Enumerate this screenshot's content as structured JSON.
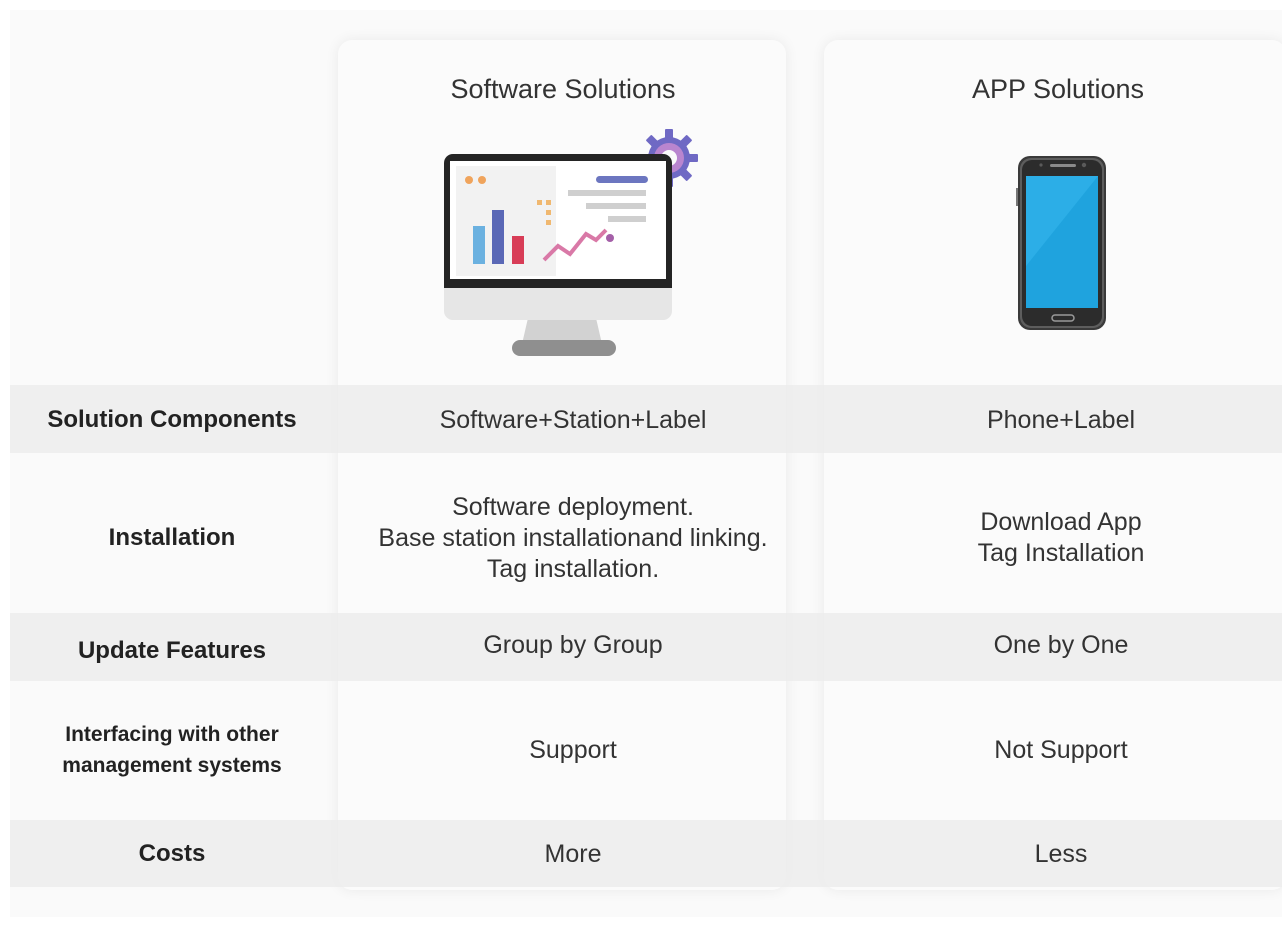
{
  "columns": {
    "software": {
      "title": "Software Solutions",
      "icon": "monitor-dashboard-icon"
    },
    "app": {
      "title": "APP Solutions",
      "icon": "smartphone-icon"
    }
  },
  "rows": [
    {
      "label": "Solution Components",
      "software": "Software+Station+Label",
      "app": "Phone+Label"
    },
    {
      "label": "Installation",
      "software": [
        "Software deployment.",
        "Base station installationand linking.",
        "Tag installation."
      ],
      "app": [
        "Download App",
        "Tag Installation"
      ]
    },
    {
      "label": "Update Features",
      "software": "Group by Group",
      "app": "One by One"
    },
    {
      "label": [
        "Interfacing with other",
        "management systems"
      ],
      "software": "Support",
      "app": "Not Support"
    },
    {
      "label": "Costs",
      "software": "More",
      "app": "Less"
    }
  ],
  "colors": {
    "band": "#ececec",
    "card": "#fbfbfb",
    "text": "#333333",
    "phone_screen": "#1fa3de",
    "gear": "#8a7ec9"
  }
}
